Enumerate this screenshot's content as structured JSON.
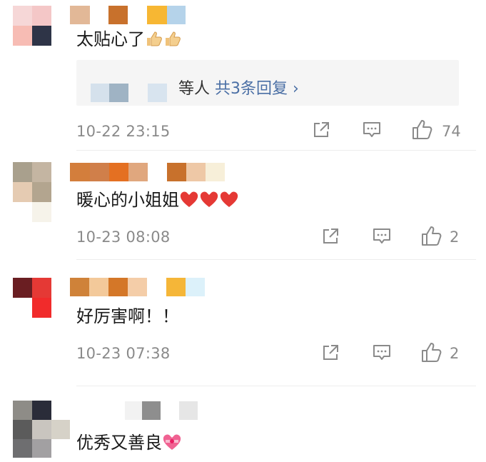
{
  "comments": [
    {
      "text": "太贴心了",
      "time": "10-22 23:15",
      "likes": "74",
      "reply_summary": {
        "prefix": "等人",
        "link": "共3条回复",
        "arrow": "›"
      },
      "emoji": [
        "thumbs-up-icon",
        "thumbs-up-icon"
      ]
    },
    {
      "text": "暖心的小姐姐",
      "time": "10-23 08:08",
      "likes": "2",
      "emoji": [
        "red-heart-icon",
        "red-heart-icon",
        "red-heart-icon"
      ]
    },
    {
      "text": "好厉害啊！！",
      "time": "10-23 07:38",
      "likes": "2"
    },
    {
      "text": "优秀又善良",
      "emoji": [
        "heart-with-ribbon-icon"
      ]
    }
  ],
  "actions": [
    "share-icon",
    "comment-icon",
    "like-icon"
  ],
  "colors": {
    "meta_gray": "#8a8a8a",
    "link_blue": "#4a6fa5",
    "reply_bg": "#f5f5f5",
    "heart_red": "#e53935"
  }
}
